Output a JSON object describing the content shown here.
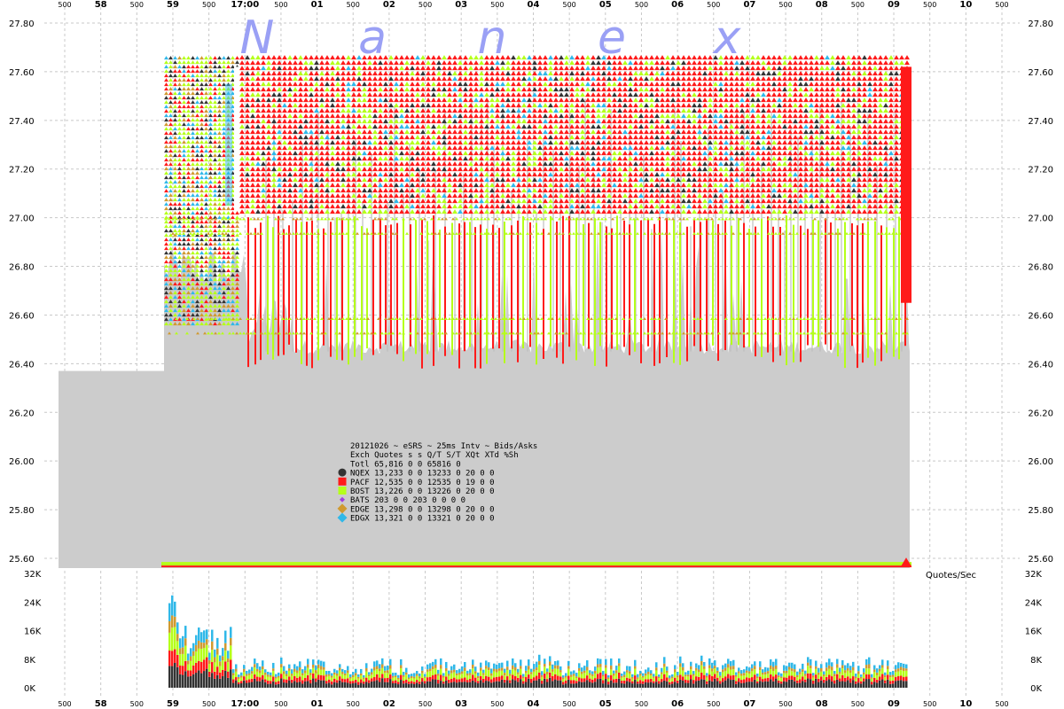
{
  "watermark": [
    "N",
    "a",
    "n",
    "e",
    "x"
  ],
  "legend": {
    "header1": "20121026 ~ eSRS ~ 25ms Intv ~ Bids/Asks",
    "header2": "Exch Quotes s s  Q/T   S/T  XQt XTd %Sh",
    "total_row": "Totl 65,816 0 0 65816     0",
    "rows": [
      {
        "text": "NQEX 13,233 0 0 13233     0  20   0   0",
        "color": "#333333",
        "marker": "circle"
      },
      {
        "text": "PACF 12,535 0 0 12535     0  19   0   0",
        "color": "#ff1a1a",
        "marker": "square"
      },
      {
        "text": "BOST 13,226 0 0 13226     0  20   0   0",
        "color": "#b5ff1a",
        "marker": "square"
      },
      {
        "text": "BATS    203 0 0   203     0   0   0   0",
        "color": "#a040e0",
        "marker": "diamond"
      },
      {
        "text": "EDGE 13,298 0 0 13298     0  20   0   0",
        "color": "#d09a30",
        "marker": "diamond"
      },
      {
        "text": "EDGX 13,321 0 0 13321     0  20   0   0",
        "color": "#30b8e8",
        "marker": "diamond"
      }
    ]
  },
  "qps_label": "Quotes/Sec",
  "chart_data": [
    {
      "type": "scatter",
      "title": "",
      "xlabel": "",
      "ylabel": "",
      "x_ticks": [
        "500",
        "58",
        "500",
        "59",
        "500",
        "17:00",
        "500",
        "01",
        "500",
        "02",
        "500",
        "03",
        "500",
        "04",
        "500",
        "05",
        "500",
        "06",
        "500",
        "07",
        "500",
        "08",
        "500",
        "09",
        "500",
        "10",
        "500"
      ],
      "major_x_ticks": [
        "58",
        "59",
        "17:00",
        "01",
        "02",
        "03",
        "04",
        "05",
        "06",
        "07",
        "08",
        "09",
        "10"
      ],
      "y_ticks": [
        "27.80",
        "27.60",
        "27.40",
        "27.20",
        "27.00",
        "26.80",
        "26.60",
        "26.40",
        "26.20",
        "26.00",
        "25.80",
        "25.60"
      ],
      "ylim": [
        25.56,
        27.8
      ],
      "bid_range": [
        26.4,
        27.0
      ],
      "ask_range": [
        27.0,
        27.65
      ],
      "spread_fill_color": "#cccccc",
      "series": [
        {
          "name": "NQEX",
          "color": "#333333"
        },
        {
          "name": "PACF",
          "color": "#ff1a1a"
        },
        {
          "name": "BOST",
          "color": "#b5ff1a"
        },
        {
          "name": "BATS",
          "color": "#a040e0"
        },
        {
          "name": "EDGE",
          "color": "#d09a30"
        },
        {
          "name": "EDGX",
          "color": "#30b8e8"
        }
      ]
    },
    {
      "type": "bar",
      "title": "",
      "ylabel": "",
      "y_ticks": [
        "32K",
        "24K",
        "16K",
        "8K",
        "0K"
      ],
      "ylim": [
        0,
        32000
      ],
      "stacked": true,
      "series": [
        {
          "name": "NQEX",
          "color": "#333333"
        },
        {
          "name": "PACF",
          "color": "#ff1a1a"
        },
        {
          "name": "BOST",
          "color": "#b5ff1a"
        },
        {
          "name": "EDGE",
          "color": "#d09a30"
        },
        {
          "name": "EDGX",
          "color": "#30b8e8"
        }
      ],
      "peak_value": 29000,
      "typical_value": 6000
    }
  ]
}
